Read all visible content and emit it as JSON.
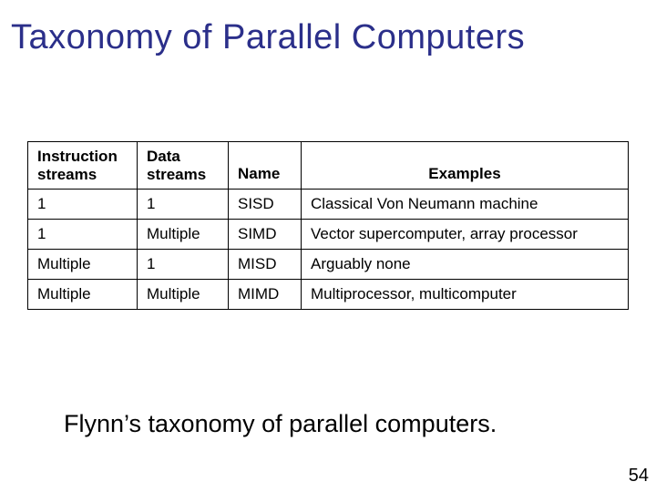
{
  "title": "Taxonomy of Parallel Computers",
  "table": {
    "headers": {
      "instruction": {
        "line1": "Instruction",
        "line2": "streams"
      },
      "data": {
        "line1": "Data",
        "line2": "streams"
      },
      "name": "Name",
      "examples": "Examples"
    },
    "rows": [
      {
        "instruction": "1",
        "data": "1",
        "name": "SISD",
        "examples": "Classical Von Neumann machine"
      },
      {
        "instruction": "1",
        "data": "Multiple",
        "name": "SIMD",
        "examples": "Vector supercomputer, array processor"
      },
      {
        "instruction": "Multiple",
        "data": "1",
        "name": "MISD",
        "examples": "Arguably none"
      },
      {
        "instruction": "Multiple",
        "data": "Multiple",
        "name": "MIMD",
        "examples": "Multiprocessor, multicomputer"
      }
    ]
  },
  "caption": "Flynn’s taxonomy of parallel computers.",
  "page_number": "54"
}
